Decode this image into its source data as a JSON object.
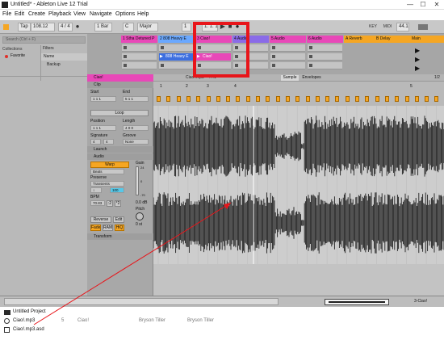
{
  "window": {
    "title": "Untitled* - Ableton Live 12 Trial",
    "minimize": "—",
    "maximize": "☐",
    "close": "✕"
  },
  "menu": [
    "File",
    "Edit",
    "Create",
    "Playback",
    "View",
    "Navigate",
    "Options",
    "Help"
  ],
  "transport": {
    "tap": "Tap",
    "tempo": "108.12",
    "time_sig": "4 / 4",
    "quantize": "1 Bar",
    "key": "C",
    "scale": "Major",
    "position": "1",
    "bar_position": "1. 1. 1",
    "key_label": "KEY",
    "midi_label": "MIDI",
    "sample_rate": "44.1"
  },
  "browser": {
    "search_placeholder": "Search (Ctrl + F)",
    "collections_label": "Collections",
    "favorite": "Favorite",
    "filters_label": "Filters",
    "name_header": "Name",
    "backup": "Backup"
  },
  "tracks": [
    {
      "label": "1 Stha Detuned P",
      "color": "#e848b8"
    },
    {
      "label": "2 808 Heavy E",
      "color": "#6aa8ff"
    },
    {
      "label": "3 Ciao!",
      "color": "#e848b8"
    },
    {
      "label": "4 Audio",
      "color": "#8a6be8"
    },
    {
      "label": "5 Audio",
      "color": "#e848b8"
    },
    {
      "label": "6 Audio",
      "color": "#e848b8"
    },
    {
      "label": "A Reverb",
      "color": "#f5a623"
    },
    {
      "label": "B Delay",
      "color": "#f5a623"
    },
    {
      "label": "Main",
      "color": "#f5a623"
    }
  ],
  "clips": {
    "track2_clip": "808 Heavy E",
    "track3_clip": "Ciao!"
  },
  "clip_view": {
    "name": "Ciao!",
    "clip_section": "Clip",
    "start_label": "Start",
    "end_label": "End",
    "start_value": "1 1 1",
    "end_value": "5 1 1",
    "loop_button": "Loop",
    "position_label": "Position",
    "length_label": "Length",
    "position_value": "1 1 1",
    "length_value": "4 0 0",
    "signature_label": "Signature",
    "groove_label": "Groove",
    "sig_num": "4",
    "sig_den": "4",
    "groove_value": "None",
    "launch_section": "Launch",
    "audio_section": "Audio",
    "warp_button": "Warp",
    "gain_label": "Gain",
    "warp_mode": "Beats",
    "preserve_label": "Preserve",
    "preserve_value": "Transients",
    "loop_mode": "↕",
    "loop_value": "100",
    "gain_value": "0.0 dB",
    "bpm_label": "BPM",
    "bpm_value": "70.83",
    "pitch_label": "Pitch",
    "pitch_value": "0 st",
    "gain_max": "24",
    "gain_zero": "0",
    "gain_min": "-70",
    "reverse_button": "Reverse",
    "edit_button": "Edit",
    "fade_button": "Fade",
    "ram_button": "RAM",
    "hiq_button": "HiQ",
    "transform_section": "Transform"
  },
  "sample_editor": {
    "filename": "Ciao!.mp3",
    "sample_rate": "44.1",
    "tab_sample": "Sample",
    "tab_envelopes": "Envelopes",
    "ticks": [
      "1",
      "2",
      "3",
      "4",
      "5"
    ],
    "page": "1/2"
  },
  "status": {
    "track_label": "3-Ciao!"
  },
  "explorer": {
    "project": "Untitled Project",
    "files": [
      {
        "name": "Ciao!.mp3",
        "num": "5",
        "title": "Ciao!",
        "artist": "Bryson Tiller",
        "album": "Bryson Tiller"
      },
      {
        "name": "Ciao!.mp3.asd"
      }
    ]
  },
  "colors": {
    "annotation_red": "#e8151a",
    "accent_orange": "#f5a623"
  }
}
